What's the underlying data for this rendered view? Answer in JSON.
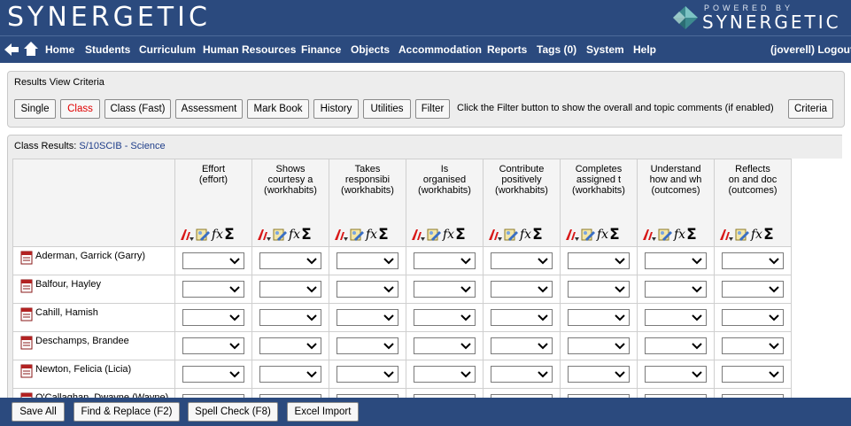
{
  "app": {
    "title": "SYNERGETIC",
    "logo_tagline": "POWERED BY",
    "logo_name": "SYNERGETIC"
  },
  "nav": {
    "items": [
      "Home",
      "Students",
      "Curriculum",
      "Human Resources",
      "Finance",
      "Objects",
      "Accommodation",
      "Reports",
      "Tags (0)",
      "System",
      "Help"
    ],
    "user_logout": "(joverell) Logout"
  },
  "criteria": {
    "title": "Results View Criteria",
    "buttons": [
      "Single",
      "Class",
      "Class (Fast)",
      "Assessment",
      "Mark Book",
      "History",
      "Utilities",
      "Filter"
    ],
    "active_button": "Class",
    "hint": "Click the Filter button to show the overall and topic comments (if enabled)",
    "criteria_button": "Criteria"
  },
  "results": {
    "title_prefix": "Class Results: ",
    "class_link": "S/10SCIB - Science",
    "columns": [
      {
        "l1": "Effort",
        "l2": "(effort)",
        "l3": ""
      },
      {
        "l1": "Shows",
        "l2": "courtesy a",
        "l3": "(workhabits)"
      },
      {
        "l1": "Takes",
        "l2": "responsibi",
        "l3": "(workhabits)"
      },
      {
        "l1": "Is",
        "l2": "organised",
        "l3": "(workhabits)"
      },
      {
        "l1": "Contribute",
        "l2": "positively",
        "l3": "(workhabits)"
      },
      {
        "l1": "Completes",
        "l2": "assigned t",
        "l3": "(workhabits)"
      },
      {
        "l1": "Understand",
        "l2": "how and wh",
        "l3": "(outcomes)"
      },
      {
        "l1": "Reflects",
        "l2": "on and doc",
        "l3": "(outcomes)"
      }
    ],
    "students": [
      "Aderman, Garrick (Garry)",
      "Balfour, Hayley",
      "Cahill, Hamish",
      "Deschamps, Brandee",
      "Newton, Felicia (Licia)",
      "O'Callaghan, Dwayne (Wayne)"
    ]
  },
  "footer": {
    "buttons": [
      "Save All",
      "Find & Replace (F2)",
      "Spell Check (F8)",
      "Excel Import"
    ]
  },
  "colors": {
    "header_blue": "#2b4a7e",
    "active_red": "#e00000",
    "link_blue": "#1f3e8a"
  }
}
